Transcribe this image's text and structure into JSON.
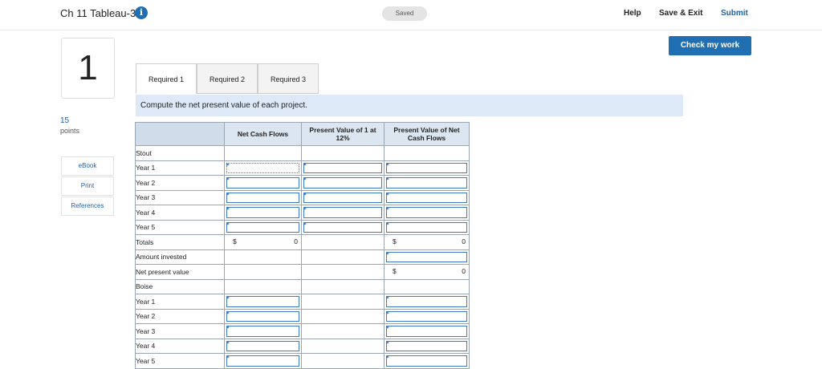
{
  "header": {
    "title": "Ch 11 Tableau-3",
    "saved": "Saved",
    "help": "Help",
    "save_exit": "Save & Exit",
    "submit": "Submit",
    "check": "Check my work"
  },
  "question": {
    "number": "1",
    "points_value": "15",
    "points_label": "points",
    "links": [
      "eBook",
      "Print",
      "References"
    ]
  },
  "tabs": [
    "Required 1",
    "Required 2",
    "Required 3"
  ],
  "instruction": "Compute the net present value of each project.",
  "table": {
    "headers": [
      "",
      "Net Cash Flows",
      "Present Value of 1 at 12%",
      "Present Value of Net Cash Flows"
    ],
    "stout_label": "Stout",
    "stout_years": [
      "Year 1",
      "Year 2",
      "Year 3",
      "Year 4",
      "Year 5"
    ],
    "totals_label": "Totals",
    "totals_currency": "$",
    "totals_ncf": "0",
    "totals_pv": "0",
    "amount_invested": "Amount invested",
    "npv_label": "Net present value",
    "npv_currency": "$",
    "npv_value": "0",
    "boise_label": "Boise",
    "boise_years": [
      "Year 1",
      "Year 2",
      "Year 3",
      "Year 4",
      "Year 5"
    ]
  },
  "colors": {
    "accent": "#1f6fb2",
    "link": "#1f5fa8",
    "instruction_bg": "#dde9f6"
  }
}
